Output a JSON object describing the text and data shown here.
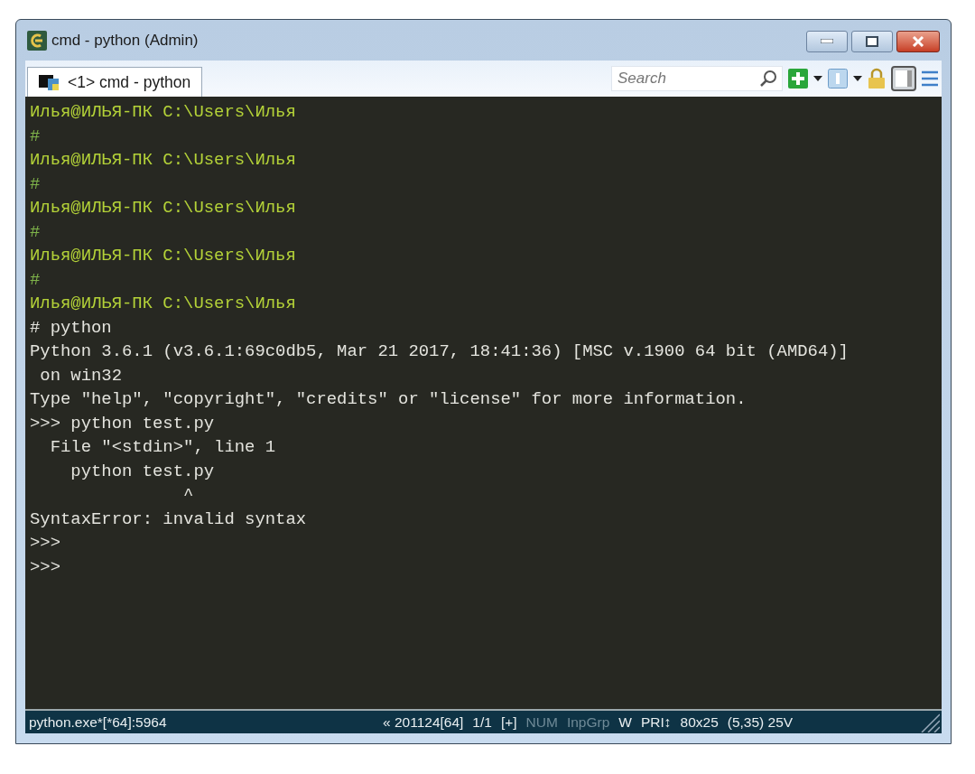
{
  "window": {
    "title": "cmd - python (Admin)"
  },
  "tabs": [
    {
      "label": "<1> cmd - python",
      "selected": true
    }
  ],
  "search": {
    "placeholder": "Search"
  },
  "console": {
    "lines": [
      {
        "kind": "prompt",
        "text": "Илья@ИЛЬЯ-ПК C:\\Users\\Илья"
      },
      {
        "kind": "hash",
        "text": "#"
      },
      {
        "kind": "prompt",
        "text": "Илья@ИЛЬЯ-ПК C:\\Users\\Илья"
      },
      {
        "kind": "hash",
        "text": "#"
      },
      {
        "kind": "prompt",
        "text": "Илья@ИЛЬЯ-ПК C:\\Users\\Илья"
      },
      {
        "kind": "hash",
        "text": "#"
      },
      {
        "kind": "prompt",
        "text": "Илья@ИЛЬЯ-ПК C:\\Users\\Илья"
      },
      {
        "kind": "hash",
        "text": "#"
      },
      {
        "kind": "prompt",
        "text": "Илья@ИЛЬЯ-ПК C:\\Users\\Илья"
      },
      {
        "kind": "output",
        "text": "# python"
      },
      {
        "kind": "output",
        "text": "Python 3.6.1 (v3.6.1:69c0db5, Mar 21 2017, 18:41:36) [MSC v.1900 64 bit (AMD64)]"
      },
      {
        "kind": "output",
        "text": " on win32"
      },
      {
        "kind": "output",
        "text": "Type \"help\", \"copyright\", \"credits\" or \"license\" for more information."
      },
      {
        "kind": "output",
        "text": ">>> python test.py"
      },
      {
        "kind": "output",
        "text": "  File \"<stdin>\", line 1"
      },
      {
        "kind": "output",
        "text": "    python test.py"
      },
      {
        "kind": "output",
        "text": "               ^"
      },
      {
        "kind": "output",
        "text": "SyntaxError: invalid syntax"
      },
      {
        "kind": "output",
        "text": ">>>"
      },
      {
        "kind": "output",
        "text": ">>>"
      }
    ]
  },
  "status_bar": {
    "process": "python.exe*[*64]:5964",
    "items": [
      {
        "text": "« 201124[64]",
        "disabled": false
      },
      {
        "text": "1/1",
        "disabled": false
      },
      {
        "text": "[+]",
        "disabled": false
      },
      {
        "text": "NUM",
        "disabled": true
      },
      {
        "text": "InpGrp",
        "disabled": true
      },
      {
        "text": "W",
        "disabled": false
      },
      {
        "text": "PRI↕",
        "disabled": false
      },
      {
        "text": "80x25",
        "disabled": false
      },
      {
        "text": "(5,35) 25V",
        "disabled": false
      }
    ]
  }
}
